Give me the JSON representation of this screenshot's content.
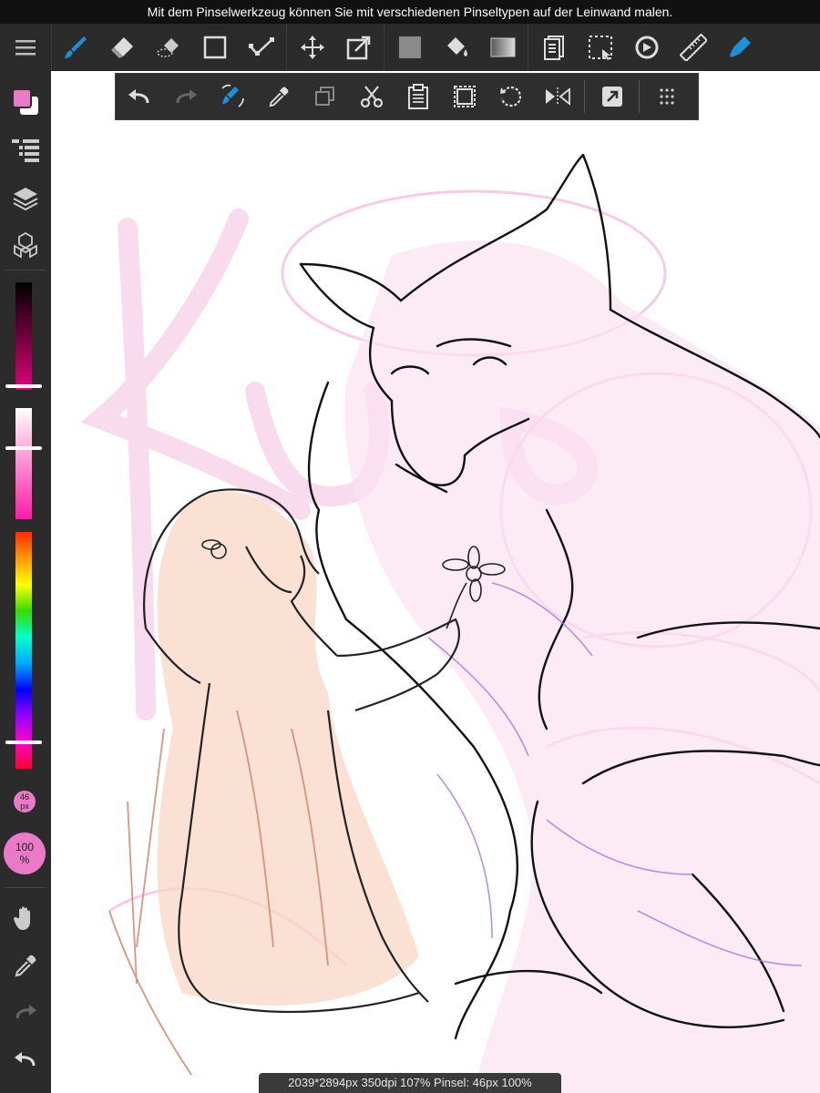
{
  "banner": {
    "text": "Mit dem Pinselwerkzeug können Sie mit verschiedenen Pinseltypen auf der Leinwand malen."
  },
  "toolbar": {
    "items": [
      "menu-icon",
      "brush-icon",
      "eraser-icon",
      "smudge-icon",
      "rectangle-icon",
      "transform-icon",
      "move-icon",
      "resize-icon",
      "fill-color-icon",
      "bucket-icon",
      "gradient-icon",
      "layers-doc-icon",
      "selection-icon",
      "rotate-view-icon",
      "ruler-icon",
      "pen-icon"
    ]
  },
  "sidebar": {
    "brush_size": "46\npx",
    "opacity": "100\n%"
  },
  "status": {
    "text": "2039*2894px 350dpi 107% Pinsel: 46px 100%"
  },
  "colors": {
    "accent": "#1f8fd6",
    "primary_color": "#e87ac8",
    "secondary_color": "#ffffff"
  }
}
